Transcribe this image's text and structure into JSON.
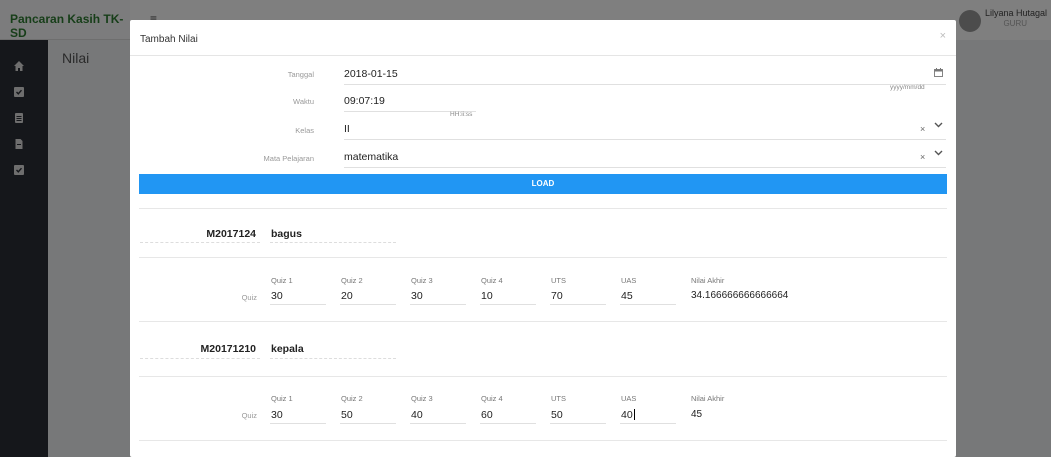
{
  "app": {
    "brand": "Pancaran Kasih TK-SD",
    "menu_glyph": "≡",
    "user_name": "Lilyana Hutagal",
    "user_role": "GURU",
    "page_title": "Nilai"
  },
  "modal": {
    "title": "Tambah Nilai",
    "close": "×",
    "fields": {
      "tanggal_label": "Tanggal",
      "tanggal_value": "2018-01-15",
      "tanggal_hint": "yyyy/mm/dd",
      "waktu_label": "Waktu",
      "waktu_value": "09:07:19",
      "waktu_hint": "HH:ii:ss",
      "kelas_label": "Kelas",
      "kelas_value": "II",
      "mapel_label": "Mata Pelajaran",
      "mapel_value": "matematika",
      "clear": "×",
      "chevron": "⌄"
    },
    "load_label": "LOAD",
    "quiz_row_label": "Quiz",
    "columns": [
      "Quiz 1",
      "Quiz 2",
      "Quiz 3",
      "Quiz 4",
      "UTS",
      "UAS",
      "Nilai Akhir"
    ],
    "students": [
      {
        "id": "M2017124",
        "name": "bagus",
        "scores": [
          "30",
          "20",
          "30",
          "10",
          "70",
          "45"
        ],
        "final": "34.166666666666664"
      },
      {
        "id": "M20171210",
        "name": "kepala",
        "scores": [
          "30",
          "50",
          "40",
          "60",
          "50",
          "40"
        ],
        "final": "45"
      }
    ]
  }
}
